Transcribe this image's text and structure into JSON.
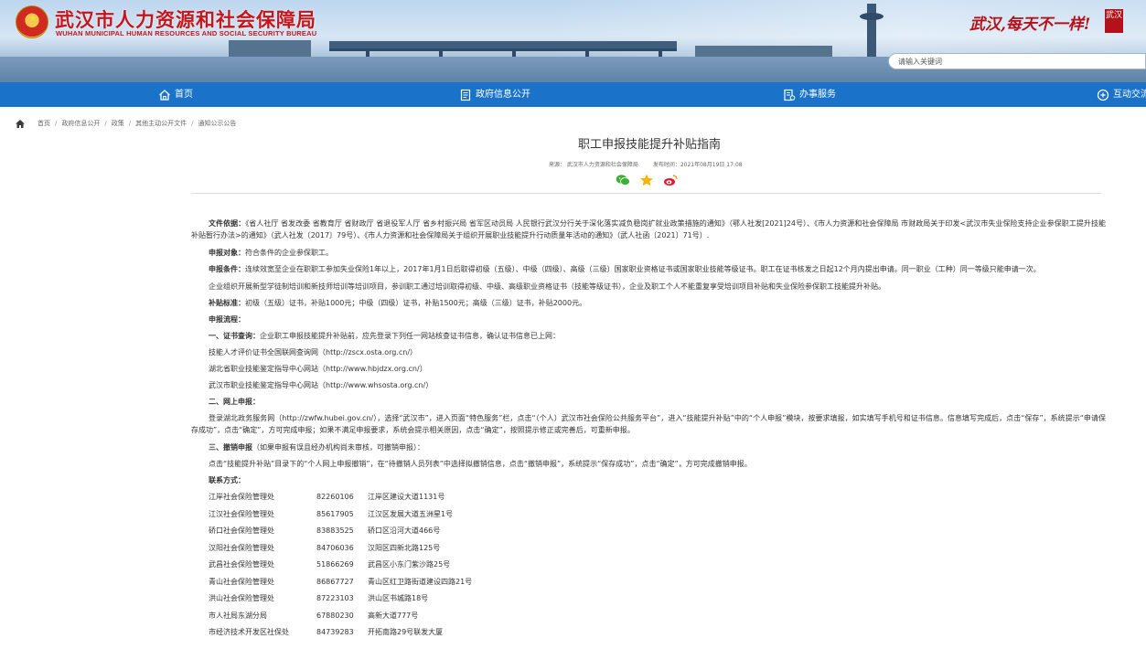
{
  "header": {
    "title": "武汉市人力资源和社会保障局",
    "subtitle": "WUHAN MUNICIPAL HUMAN RESOURCES AND SOCIAL SECURITY BUREAU",
    "slogan": "武汉,每天不一样!",
    "seal_text": "武汉",
    "search_placeholder": "请输入关键词"
  },
  "nav": {
    "items": [
      {
        "label": "首页",
        "icon": "home-icon"
      },
      {
        "label": "政府信息公开",
        "icon": "document-icon"
      },
      {
        "label": "办事服务",
        "icon": "service-icon"
      },
      {
        "label": "互动交流",
        "icon": "interaction-icon"
      }
    ]
  },
  "breadcrumb": [
    "首页",
    "政府信息公开",
    "政策",
    "其他主动公开文件",
    "通知公示公告"
  ],
  "article": {
    "title": "职工申报技能提升补贴指南",
    "source": "来源：  武汉市人力资源和社会保障局",
    "date": "发布时间：2021年08月19日 17:08"
  },
  "content": {
    "doc_label": "文件依据：",
    "doc_text": "《省人社厅 省发改委 省教育厅 省财政厅 省退役军人厅 省乡村振兴局 省军区动员局 人民银行武汉分行关于深化落实减负稳岗扩就业政策措施的通知》（鄂人社发[2021]24号）、《市人力资源和社会保障局 市财政局关于印发<武汉市失业保险支持企业参保职工提升技能补贴暂行办法>的通知》（武人社发〔2017〕79号）、《市人力资源和社会保障局关于组织开展职业技能提升行动质量年活动的通知》（武人社函〔2021〕71号）.",
    "target_label": "申报对象：",
    "target_text": "符合条件的企业参保职工。",
    "condition_label": "申报条件：",
    "condition_text": "连续效宽至企业在职职工参加失业保险1年以上，2017年1月1日后取得初级（五级）、中级（四级）、高级（三级）国家职业资格证书或国家职业技能等级证书。职工在证书核发之日起12个月内提出申请。同一职业（工种）同一等级只能申请一次。",
    "condition_text2": "企业组织开展新型学徒制培训和新技师培训等培训项目，参训职工通过培训取得初级、中级、高级职业资格证书（技能等级证书），企业及职工个人不能重复享受培训项目补贴和失业保险参保职工技能提升补贴。",
    "standard_label": "补贴标准：",
    "standard_text": "初级（五级）证书，补贴1000元；中级（四级）证书，补贴1500元；高级（三级）证书，补贴2000元。",
    "process_label": "申报流程：",
    "step1_label": "一、证书查询：",
    "step1_text": "企业职工申报技能提升补贴前，应先登录下列任一网站核查证书信息，确认证书信息已上网：",
    "sites": [
      "技能人才评价证书全国联网查询网（http://zscx.osta.org.cn/）",
      "湖北省职业技能鉴定指导中心网站（http://www.hbjdzx.org.cn/）",
      "武汉市职业技能鉴定指导中心网站（http://www.whsosta.org.cn/）"
    ],
    "step2_label": "二、网上申报：",
    "step2_text": "登录湖北政务服务网（http://zwfw.hubei.gov.cn/），选择“武汉市”，进入页面“特色服务”栏，点击“（个人）武汉市社会保险公共服务平台”，进入“技能提升补贴”中的“个人申报”模块，按要求填报，如实填写手机号和证书信息。信息填写完成后，点击“保存”，系统提示“申请保存成功”，点击“确定”，方可完成申报；如果不满足申报要求，系统会提示相关原因，点击“确定”，按照提示修正或完善后，可重新申报。",
    "step3_label": "三、撤销申报",
    "step3_note": "（如果申报有误且经办机构尚未审核，可撤销申报）：",
    "step3_text": "点击“技能提升补贴”目录下的“个人网上申报撤销”，在“待撤销人员列表”中选择拟撤销信息，点击“撤销申报”，系统提示“保存成功”，点击“确定”，方可完成撤销申报。",
    "contact_label": "联系方式：",
    "contacts": [
      {
        "name": "江岸社会保险管理处",
        "phone": "82260106",
        "address": "江岸区建设大道1131号"
      },
      {
        "name": "江汉社会保险管理处",
        "phone": "85617905",
        "address": "江汉区发展大道五洲星1号"
      },
      {
        "name": "硚口社会保险管理处",
        "phone": "83883525",
        "address": "硚口区沿河大道466号"
      },
      {
        "name": "汉阳社会保险管理处",
        "phone": "84706036",
        "address": "汉阳区四新北路125号"
      },
      {
        "name": "武昌社会保险管理处",
        "phone": "51866269",
        "address": "武昌区小东门紫沙路25号"
      },
      {
        "name": "青山社会保险管理处",
        "phone": "86867727",
        "address": "青山区红卫路街道建设四路21号"
      },
      {
        "name": "洪山社会保险管理处",
        "phone": "87223103",
        "address": "洪山区书城路18号"
      },
      {
        "name": "市人社局东湖分局",
        "phone": "67880230",
        "address": "高新大道777号"
      },
      {
        "name": "市经济技术开发区社保处",
        "phone": "84739283",
        "address": "开拓南路29号联发大厦"
      }
    ]
  }
}
